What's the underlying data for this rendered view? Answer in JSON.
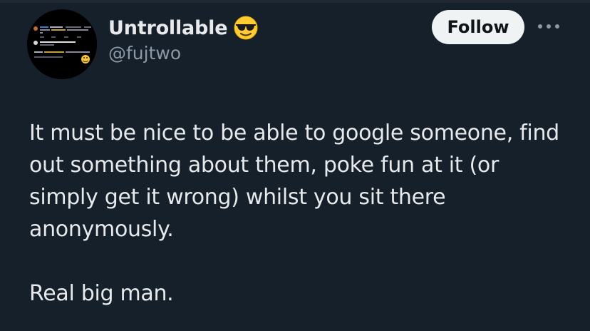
{
  "theme": {
    "background": "#15202b",
    "text_primary": "#e7e9ea",
    "text_secondary": "#8b98a5",
    "follow_button_bg": "#eff3f4",
    "follow_button_text": "#0f1419"
  },
  "author": {
    "display_name": "Untrollable",
    "name_emoji_icon": "smiling-face-with-sunglasses-icon",
    "handle": "@fujtwo",
    "avatar_icon": "profile-avatar-screenshot-image"
  },
  "actions": {
    "follow_label": "Follow",
    "more_icon": "more-horizontal-icon"
  },
  "tweet": {
    "paragraph_1": "It must be nice to be able to google someone, find out something about them, poke fun at it (or simply get it wrong) whilst you sit there anonymously.",
    "paragraph_2": "Real big man."
  }
}
